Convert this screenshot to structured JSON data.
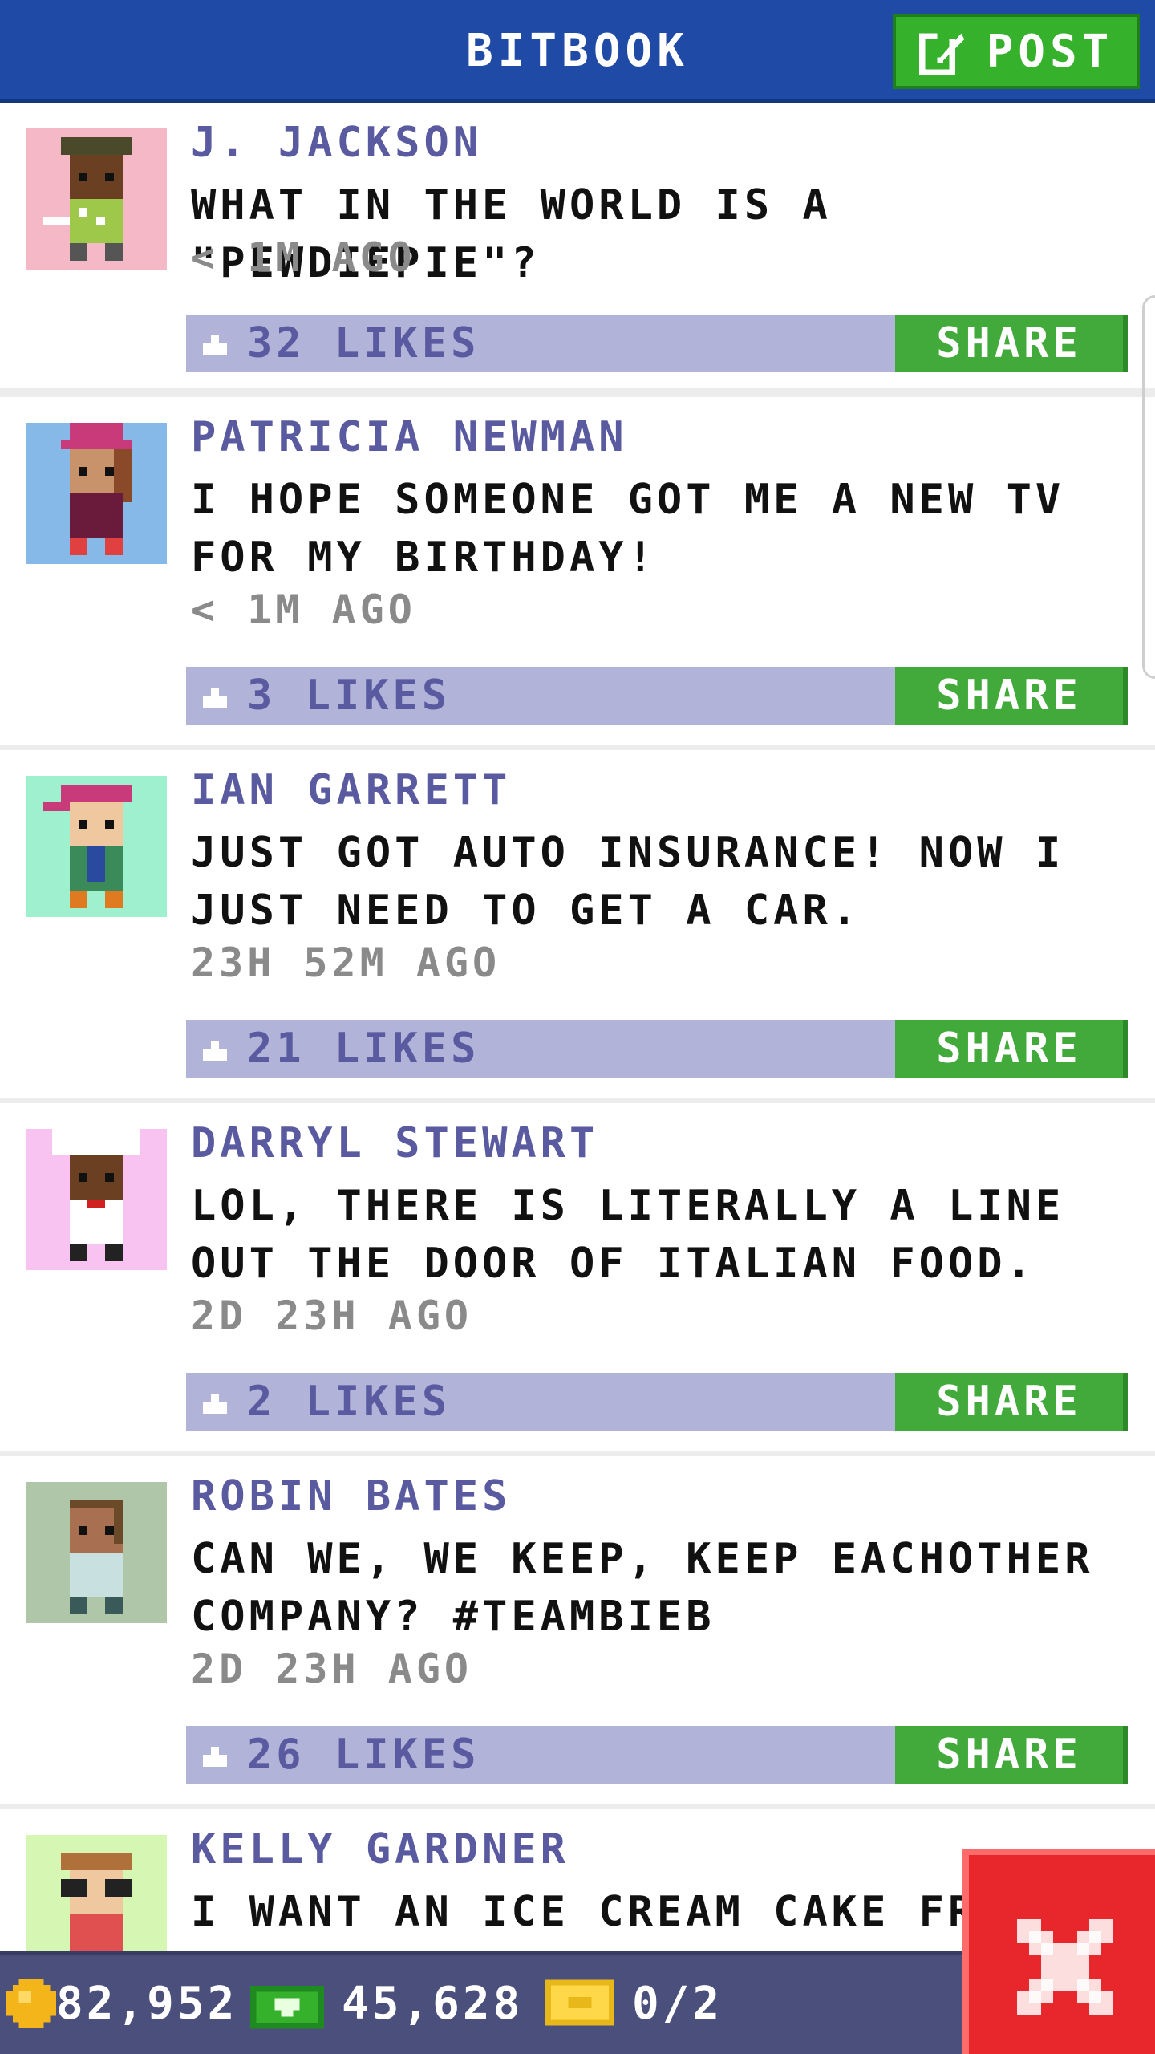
{
  "header": {
    "title": "BITBOOK",
    "post_label": "POST"
  },
  "posts": [
    {
      "name": "J. JACKSON",
      "text": "WHAT IN THE WORLD IS A \"PEWDIEPIE\"?",
      "time": "< 1M AGO",
      "likes": "32 LIKES",
      "share": "SHARE",
      "avatar_bg": "#f4b8c6"
    },
    {
      "name": "PATRICIA NEWMAN",
      "text": "I HOPE SOMEONE GOT ME A NEW TV FOR MY BIRTHDAY!",
      "time": "< 1M AGO",
      "likes": "3 LIKES",
      "share": "SHARE",
      "avatar_bg": "#86b8e8"
    },
    {
      "name": "IAN GARRETT",
      "text": "JUST GOT AUTO INSURANCE! NOW I JUST NEED TO GET A CAR.",
      "time": "23H 52M AGO",
      "likes": "21 LIKES",
      "share": "SHARE",
      "avatar_bg": "#9ef0cf"
    },
    {
      "name": "DARRYL STEWART",
      "text": "LOL, THERE IS LITERALLY A LINE OUT THE DOOR OF ITALIAN FOOD.",
      "time": "2D 23H AGO",
      "likes": "2 LIKES",
      "share": "SHARE",
      "avatar_bg": "#f8c3f0"
    },
    {
      "name": "ROBIN BATES",
      "text": "CAN WE, WE KEEP, KEEP EACHOTHER COMPANY? #TEAMBIEB",
      "time": "2D 23H AGO",
      "likes": "26 LIKES",
      "share": "SHARE",
      "avatar_bg": "#b0c6a8"
    },
    {
      "name": "KELLY GARDNER",
      "text": "I WANT AN ICE CREAM CAKE FRO",
      "time": "",
      "likes": "",
      "share": "",
      "avatar_bg": "#d6f7b4"
    }
  ],
  "status_bar": {
    "coins": "82,952",
    "cash": "45,628",
    "tickets": "0/2"
  },
  "icons": {
    "post": "edit-icon",
    "like": "thumbs-up-icon",
    "coin": "coin-icon",
    "cash": "cash-icon",
    "ticket": "ticket-icon",
    "close": "close-icon"
  },
  "colors": {
    "header": "#1f4aa6",
    "post_button": "#36b12c",
    "share_button": "#42a93b",
    "like_bar": "#b2b3d8",
    "close_button": "#e8272c",
    "bottom_bar": "#4b4f7c"
  }
}
